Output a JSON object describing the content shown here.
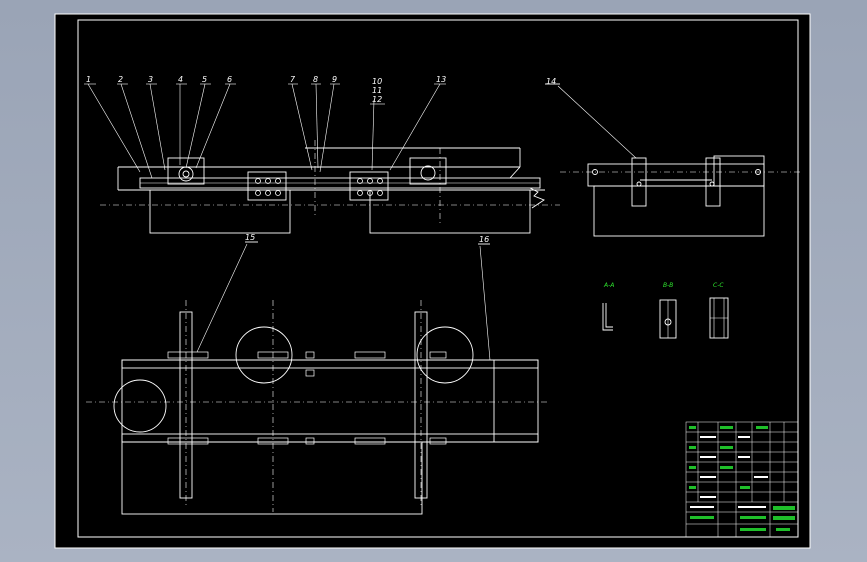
{
  "callouts_top": [
    "1",
    "2",
    "3",
    "4",
    "5",
    "6",
    "7",
    "8",
    "9",
    "10",
    "11",
    "12",
    "13",
    "14"
  ],
  "callouts_bottom": [
    "15",
    "16"
  ],
  "section_labels": [
    "A-A",
    "B-B",
    "C-C"
  ]
}
